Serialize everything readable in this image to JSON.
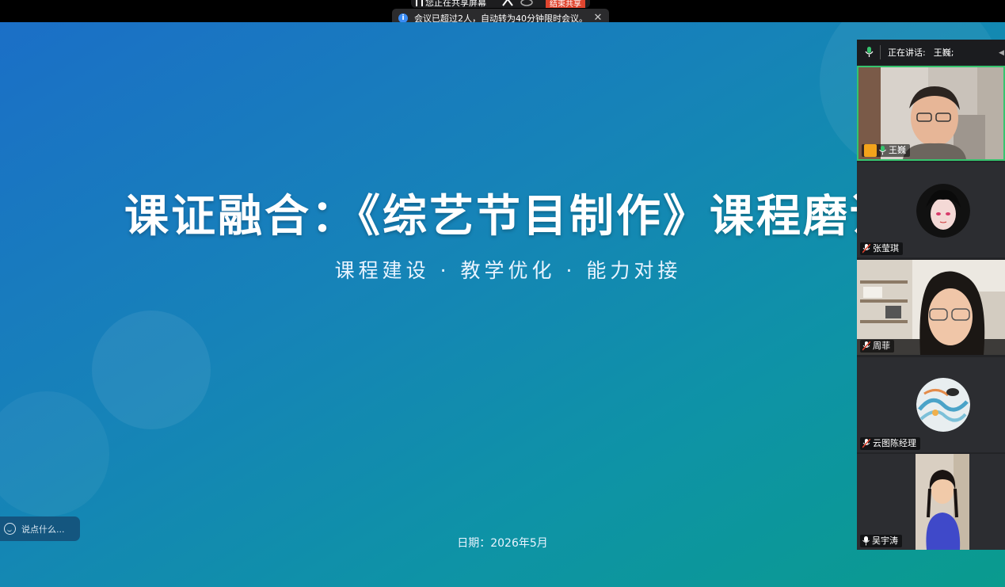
{
  "share_bar": {
    "status": "您正在共享屏幕",
    "stop_label": "结束共享"
  },
  "toast": {
    "message": "会议已超过2人，自动转为40分钟限时会议。"
  },
  "slide": {
    "title": "课证融合：《综艺节目制作》课程磨课",
    "subtitle": "课程建设 · 教学优化 · 能力对接",
    "date": "日期：2026年5月"
  },
  "chat": {
    "placeholder": "说点什么..."
  },
  "panel": {
    "speaking_label": "正在讲话:",
    "speaking_name": "王巍;",
    "participants": [
      {
        "name": "王巍",
        "role": "host",
        "mic": "on"
      },
      {
        "name": "张莹琪",
        "mic": "muted"
      },
      {
        "name": "周菲",
        "mic": "muted"
      },
      {
        "name": "云图陈经理",
        "mic": "muted"
      },
      {
        "name": "吴宇涛",
        "mic": "on"
      }
    ]
  },
  "colors": {
    "accent_green": "#36c46e",
    "stop_red": "#e0452f",
    "host_orange": "#f3a31b",
    "info_blue": "#3a8cf5"
  }
}
